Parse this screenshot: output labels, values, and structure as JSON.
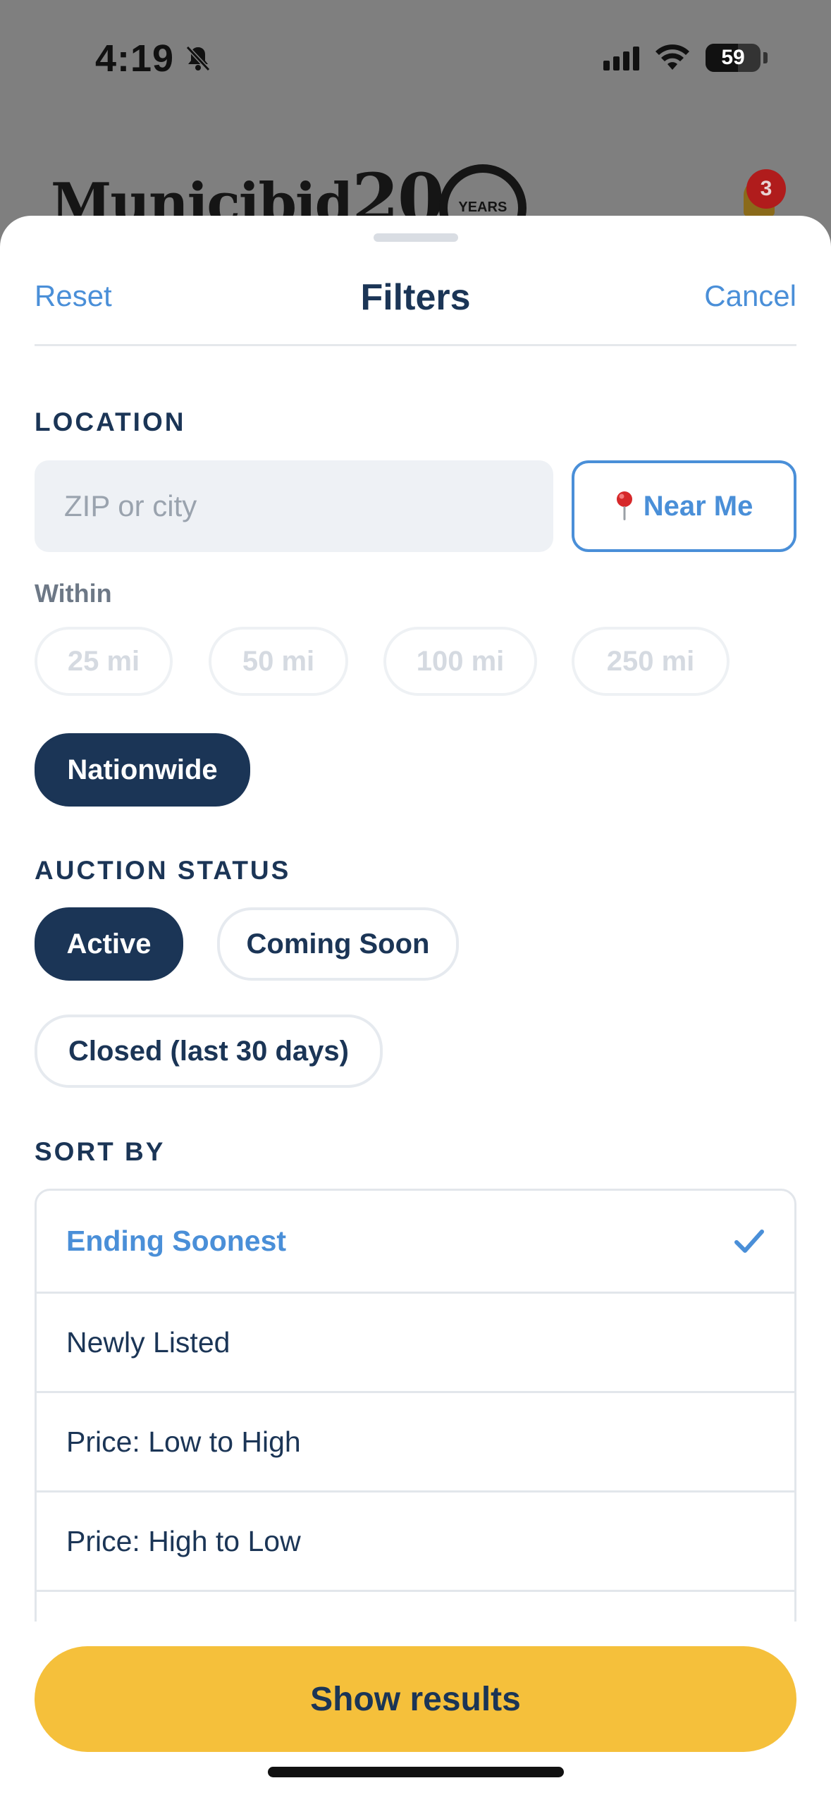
{
  "status_bar": {
    "time": "4:19",
    "battery": "59"
  },
  "background_app": {
    "logo_text": "Municibid",
    "logo_number": "20",
    "logo_years": "YEARS",
    "notification_count": "3"
  },
  "header": {
    "reset": "Reset",
    "title": "Filters",
    "cancel": "Cancel"
  },
  "location": {
    "label": "LOCATION",
    "zip_placeholder": "ZIP or city",
    "zip_value": "",
    "near_me": "Near Me",
    "within_label": "Within",
    "radius_options": [
      "25 mi",
      "50 mi",
      "100 mi",
      "250 mi",
      "Nationwide"
    ],
    "selected_radius": "Nationwide"
  },
  "auction_status": {
    "label": "AUCTION STATUS",
    "options": [
      "Active",
      "Coming Soon",
      "Closed (last 30 days)"
    ],
    "selected": "Active"
  },
  "sort_by": {
    "label": "SORT BY",
    "options": [
      "Ending Soonest",
      "Newly Listed",
      "Price: Low to High",
      "Price: High to Low"
    ],
    "selected": "Ending Soonest"
  },
  "footer": {
    "show_results": "Show results"
  },
  "colors": {
    "accent_blue": "#4a8fd8",
    "navy": "#1b3556",
    "cta_yellow": "#f5c03b"
  }
}
